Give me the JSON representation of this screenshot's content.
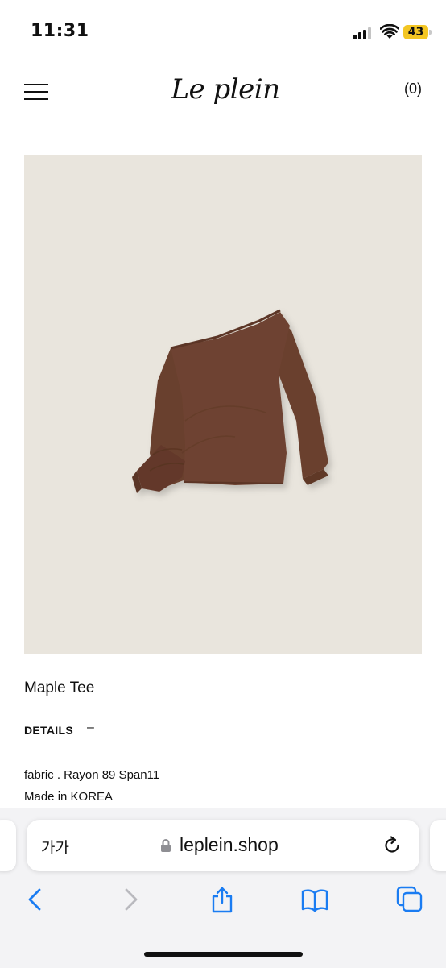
{
  "status_bar": {
    "time": "11:31",
    "battery_level": "43",
    "battery_color": "#f3c623",
    "signal_icon": "cellular-signal-icon",
    "wifi_icon": "wifi-icon"
  },
  "header": {
    "logo": "Le plein",
    "cart_label": "(0)",
    "menu_icon": "hamburger-menu-icon"
  },
  "product": {
    "image_background": "#e9e5dd",
    "garment_color": "#6e4330",
    "title": "Maple Tee",
    "details_label": "DETAILS",
    "details_toggle": "–",
    "fabric": "fabric . Rayon 89 Span11",
    "origin": "Made in KOREA"
  },
  "browser": {
    "text_size_label": "가가",
    "url": "leplein.shop",
    "lock_icon": "lock-icon",
    "reload_icon": "reload-icon",
    "toolbar_icons": [
      "back-icon",
      "forward-icon",
      "share-icon",
      "bookmarks-icon",
      "tabs-icon"
    ],
    "accent_color": "#1a7cf2"
  }
}
